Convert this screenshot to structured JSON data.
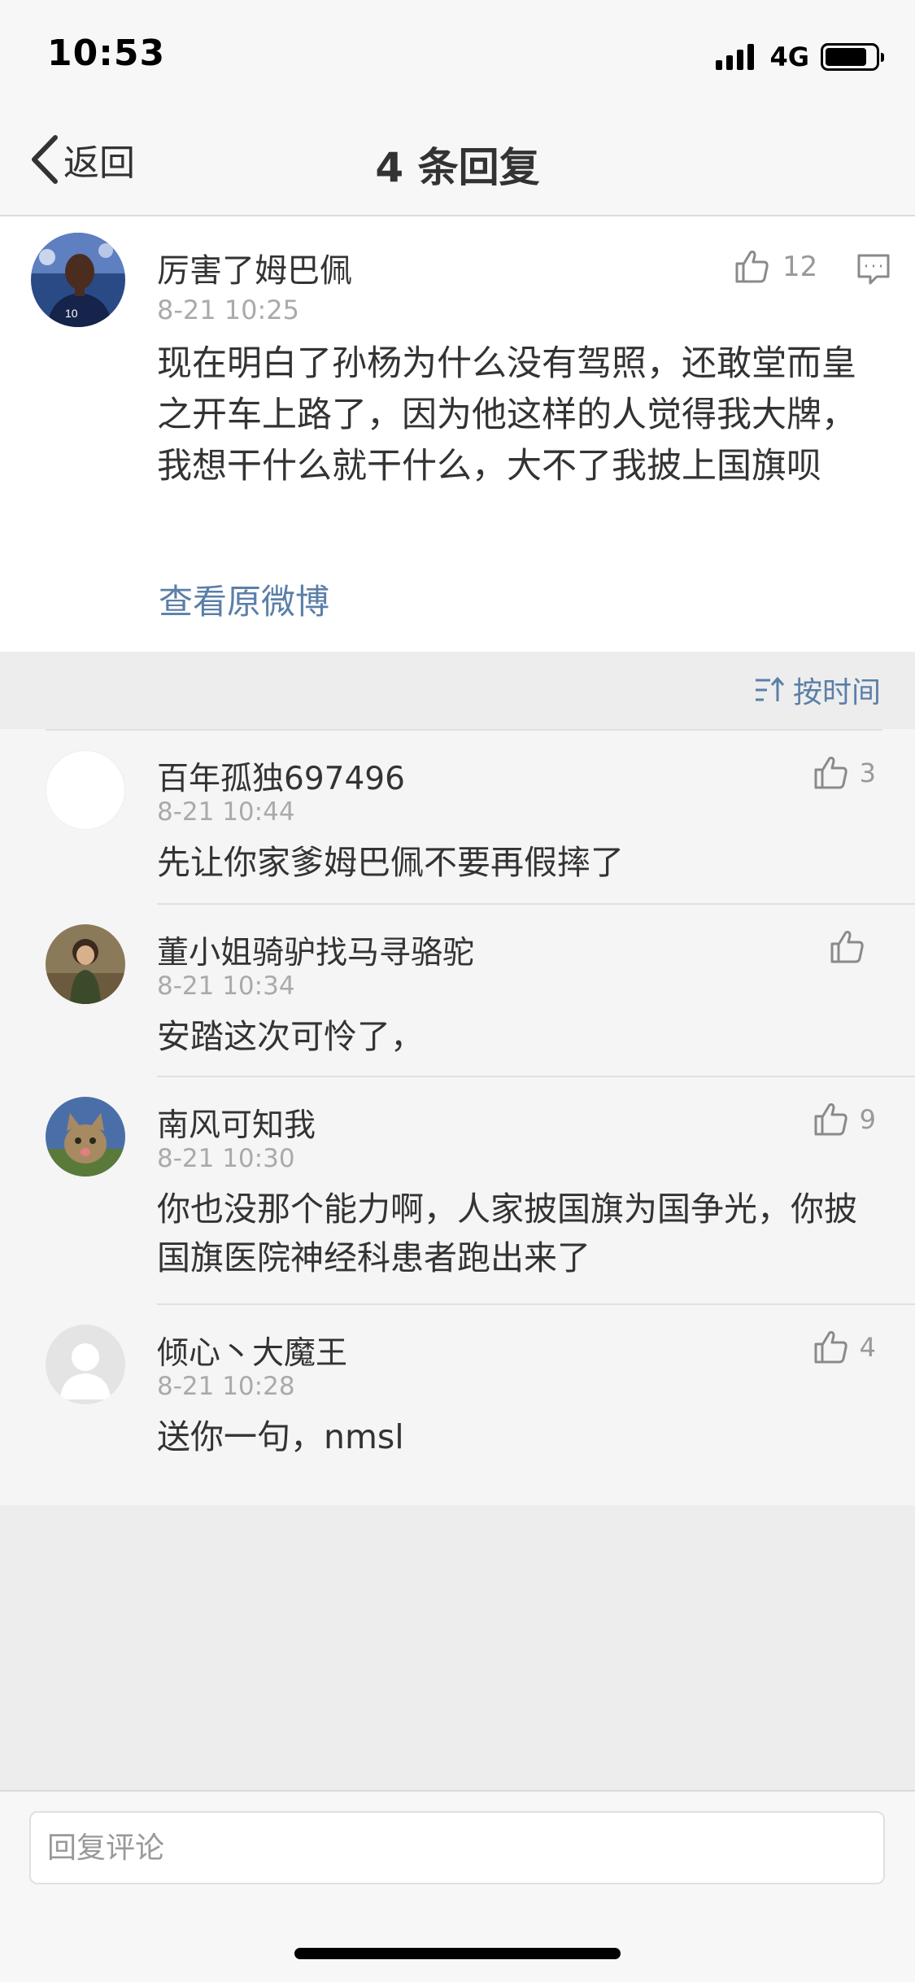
{
  "status_bar": {
    "time": "10:53",
    "network": "4G",
    "battery_level": 0.85
  },
  "nav": {
    "back_label": "返回",
    "title": "4 条回复"
  },
  "main_comment": {
    "author": "厉害了姆巴佩",
    "time": "8-21 10:25",
    "likes": "12",
    "text": "现在明白了孙杨为什么没有驾照，还敢堂而皇之开车上路了，因为他这样的人觉得我大牌，我想干什么就干什么，大不了我披上国旗呗",
    "view_original": "查看原微博"
  },
  "sort": {
    "label": "按时间"
  },
  "replies": [
    {
      "author": "百年孤独697496",
      "time": "8-21 10:44",
      "likes": "3",
      "text": "先让你家爹姆巴佩不要再假摔了"
    },
    {
      "author": "董小姐骑驴找马寻骆驼",
      "time": "8-21 10:34",
      "likes": "",
      "text": "安踏这次可怜了，"
    },
    {
      "author": "南风可知我",
      "time": "8-21 10:30",
      "likes": "9",
      "text": "你也没那个能力啊，人家披国旗为国争光，你披国旗医院神经科患者跑出来了"
    },
    {
      "author": "倾心丶大魔王",
      "time": "8-21 10:28",
      "likes": "4",
      "text": "送你一句，nmsl"
    }
  ],
  "input": {
    "placeholder": "回复评论",
    "value": ""
  },
  "colors": {
    "link": "#5b7fa8",
    "text": "#333333",
    "muted": "#aaaaaa",
    "background": "#ededed"
  }
}
